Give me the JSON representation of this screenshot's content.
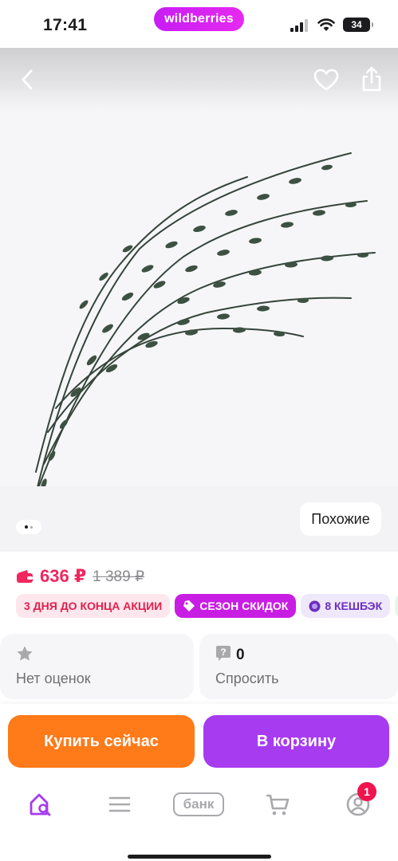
{
  "status_bar": {
    "time": "17:41",
    "brand_pill": "wildberries",
    "battery": "34",
    "icons": [
      "cellular-signal-icon",
      "wifi-icon",
      "battery-icon"
    ]
  },
  "gallery": {
    "icons": [
      "back-arrow-icon",
      "heart-icon",
      "share-icon"
    ],
    "similar_label": "Похожие",
    "image_count": 2,
    "current_image": 1
  },
  "price": {
    "current": "636 ₽",
    "old": "1 389 ₽",
    "color": "#f0265f",
    "icon": "wallet-icon"
  },
  "badges": [
    {
      "label": "3 ДНЯ ДО КОНЦА АКЦИИ"
    },
    {
      "label": "СЕЗОН СКИДОК",
      "icon": "tag-icon"
    },
    {
      "label": "8 КЕШБЭК",
      "icon": "coin-icon"
    },
    {
      "label": "",
      "icon": "clover-icon"
    }
  ],
  "cards": {
    "rating": {
      "icon": "star-icon",
      "label": "Нет оценок"
    },
    "questions": {
      "icon": "question-bubble-icon",
      "count": "0",
      "label": "Спросить"
    }
  },
  "actions": {
    "buy_now": "Купить сейчас",
    "add_to_cart": "В корзину",
    "buy_color": "#ff7a19",
    "cart_color": "#a73bf0"
  },
  "tabbar": {
    "items": [
      {
        "name": "home",
        "icon": "home-search-icon",
        "active": true
      },
      {
        "name": "catalog",
        "icon": "menu-icon"
      },
      {
        "name": "bank",
        "label": "банк"
      },
      {
        "name": "cart",
        "icon": "cart-icon"
      },
      {
        "name": "profile",
        "icon": "profile-icon",
        "badge": "1"
      }
    ],
    "accent": "#a73bf0"
  }
}
